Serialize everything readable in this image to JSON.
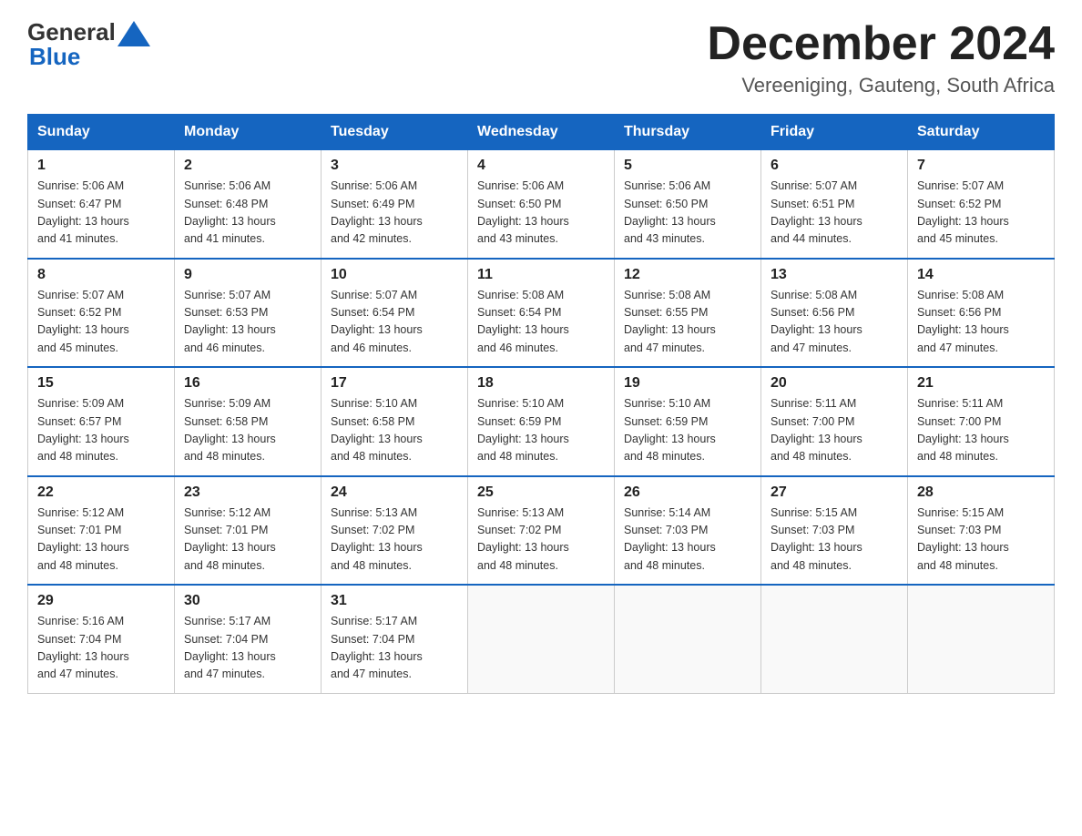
{
  "logo": {
    "general": "General",
    "blue": "Blue",
    "tagline": "Blue"
  },
  "header": {
    "month_year": "December 2024",
    "location": "Vereeniging, Gauteng, South Africa"
  },
  "weekdays": [
    "Sunday",
    "Monday",
    "Tuesday",
    "Wednesday",
    "Thursday",
    "Friday",
    "Saturday"
  ],
  "weeks": [
    [
      {
        "day": "1",
        "sunrise": "5:06 AM",
        "sunset": "6:47 PM",
        "daylight": "13 hours and 41 minutes."
      },
      {
        "day": "2",
        "sunrise": "5:06 AM",
        "sunset": "6:48 PM",
        "daylight": "13 hours and 41 minutes."
      },
      {
        "day": "3",
        "sunrise": "5:06 AM",
        "sunset": "6:49 PM",
        "daylight": "13 hours and 42 minutes."
      },
      {
        "day": "4",
        "sunrise": "5:06 AM",
        "sunset": "6:50 PM",
        "daylight": "13 hours and 43 minutes."
      },
      {
        "day": "5",
        "sunrise": "5:06 AM",
        "sunset": "6:50 PM",
        "daylight": "13 hours and 43 minutes."
      },
      {
        "day": "6",
        "sunrise": "5:07 AM",
        "sunset": "6:51 PM",
        "daylight": "13 hours and 44 minutes."
      },
      {
        "day": "7",
        "sunrise": "5:07 AM",
        "sunset": "6:52 PM",
        "daylight": "13 hours and 45 minutes."
      }
    ],
    [
      {
        "day": "8",
        "sunrise": "5:07 AM",
        "sunset": "6:52 PM",
        "daylight": "13 hours and 45 minutes."
      },
      {
        "day": "9",
        "sunrise": "5:07 AM",
        "sunset": "6:53 PM",
        "daylight": "13 hours and 46 minutes."
      },
      {
        "day": "10",
        "sunrise": "5:07 AM",
        "sunset": "6:54 PM",
        "daylight": "13 hours and 46 minutes."
      },
      {
        "day": "11",
        "sunrise": "5:08 AM",
        "sunset": "6:54 PM",
        "daylight": "13 hours and 46 minutes."
      },
      {
        "day": "12",
        "sunrise": "5:08 AM",
        "sunset": "6:55 PM",
        "daylight": "13 hours and 47 minutes."
      },
      {
        "day": "13",
        "sunrise": "5:08 AM",
        "sunset": "6:56 PM",
        "daylight": "13 hours and 47 minutes."
      },
      {
        "day": "14",
        "sunrise": "5:08 AM",
        "sunset": "6:56 PM",
        "daylight": "13 hours and 47 minutes."
      }
    ],
    [
      {
        "day": "15",
        "sunrise": "5:09 AM",
        "sunset": "6:57 PM",
        "daylight": "13 hours and 48 minutes."
      },
      {
        "day": "16",
        "sunrise": "5:09 AM",
        "sunset": "6:58 PM",
        "daylight": "13 hours and 48 minutes."
      },
      {
        "day": "17",
        "sunrise": "5:10 AM",
        "sunset": "6:58 PM",
        "daylight": "13 hours and 48 minutes."
      },
      {
        "day": "18",
        "sunrise": "5:10 AM",
        "sunset": "6:59 PM",
        "daylight": "13 hours and 48 minutes."
      },
      {
        "day": "19",
        "sunrise": "5:10 AM",
        "sunset": "6:59 PM",
        "daylight": "13 hours and 48 minutes."
      },
      {
        "day": "20",
        "sunrise": "5:11 AM",
        "sunset": "7:00 PM",
        "daylight": "13 hours and 48 minutes."
      },
      {
        "day": "21",
        "sunrise": "5:11 AM",
        "sunset": "7:00 PM",
        "daylight": "13 hours and 48 minutes."
      }
    ],
    [
      {
        "day": "22",
        "sunrise": "5:12 AM",
        "sunset": "7:01 PM",
        "daylight": "13 hours and 48 minutes."
      },
      {
        "day": "23",
        "sunrise": "5:12 AM",
        "sunset": "7:01 PM",
        "daylight": "13 hours and 48 minutes."
      },
      {
        "day": "24",
        "sunrise": "5:13 AM",
        "sunset": "7:02 PM",
        "daylight": "13 hours and 48 minutes."
      },
      {
        "day": "25",
        "sunrise": "5:13 AM",
        "sunset": "7:02 PM",
        "daylight": "13 hours and 48 minutes."
      },
      {
        "day": "26",
        "sunrise": "5:14 AM",
        "sunset": "7:03 PM",
        "daylight": "13 hours and 48 minutes."
      },
      {
        "day": "27",
        "sunrise": "5:15 AM",
        "sunset": "7:03 PM",
        "daylight": "13 hours and 48 minutes."
      },
      {
        "day": "28",
        "sunrise": "5:15 AM",
        "sunset": "7:03 PM",
        "daylight": "13 hours and 48 minutes."
      }
    ],
    [
      {
        "day": "29",
        "sunrise": "5:16 AM",
        "sunset": "7:04 PM",
        "daylight": "13 hours and 47 minutes."
      },
      {
        "day": "30",
        "sunrise": "5:17 AM",
        "sunset": "7:04 PM",
        "daylight": "13 hours and 47 minutes."
      },
      {
        "day": "31",
        "sunrise": "5:17 AM",
        "sunset": "7:04 PM",
        "daylight": "13 hours and 47 minutes."
      },
      null,
      null,
      null,
      null
    ]
  ]
}
